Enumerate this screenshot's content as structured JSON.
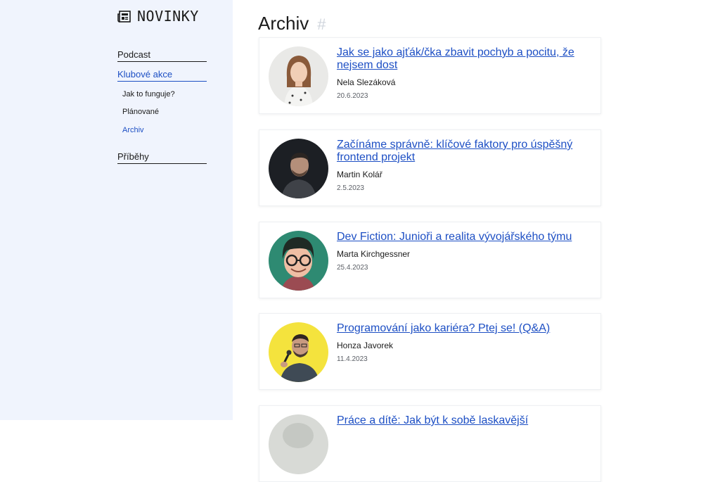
{
  "brand": {
    "name": "NOVINKY",
    "icon": "newspaper-icon"
  },
  "nav": {
    "podcast": "Podcast",
    "klubove_akce": "Klubové akce",
    "sub": {
      "jak_to_funguje": "Jak to funguje?",
      "planovane": "Plánované",
      "archiv": "Archiv"
    },
    "pribehy": "Příběhy"
  },
  "page": {
    "title": "Archiv",
    "anchor": "#"
  },
  "colors": {
    "accent": "#1d4fc4",
    "sidebar_bg": "#f0f4fd"
  },
  "articles": [
    {
      "title": "Jak se jako ajťák/čka zbavit pochyb a pocitu, že nejsem dost",
      "author": "Nela Slezáková",
      "date": "20.6.2023"
    },
    {
      "title": "Začínáme správně: klíčové faktory pro úspěšný frontend projekt",
      "author": "Martin Kolář",
      "date": "2.5.2023"
    },
    {
      "title": "Dev Fiction: Junioři a realita vývojářského týmu",
      "author": "Marta Kirchgessner",
      "date": "25.4.2023"
    },
    {
      "title": "Programování jako kariéra? Ptej se! (Q&A)",
      "author": "Honza Javorek",
      "date": "11.4.2023"
    },
    {
      "title": "Práce a dítě: Jak být k sobě laskavější",
      "author": "",
      "date": ""
    }
  ]
}
